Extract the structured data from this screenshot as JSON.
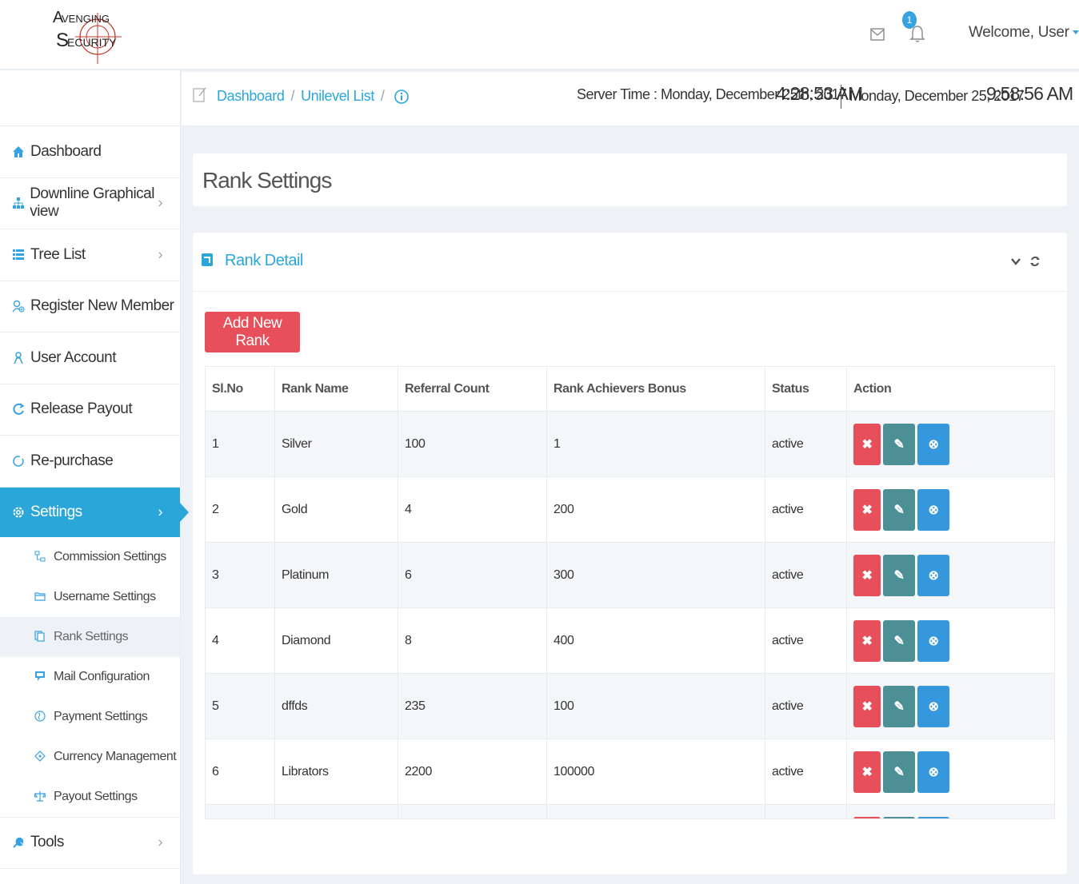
{
  "brand": {
    "logo_lines": [
      "VENGING",
      "ECURITY"
    ],
    "logo_initials": [
      "A",
      "S"
    ]
  },
  "header": {
    "notification_count": "1",
    "welcome": "Welcome, User",
    "accent": "#2ba6d9"
  },
  "sidebar": {
    "items": [
      {
        "label": "Dashboard",
        "icon": "home-icon"
      },
      {
        "label": "Downline Graphical view",
        "icon": "sitemap-icon"
      },
      {
        "label": "Tree List",
        "icon": "list-icon"
      },
      {
        "label": "Register New Member",
        "icon": "user-add-icon"
      },
      {
        "label": "User Account",
        "icon": "user-icon"
      },
      {
        "label": "Release Payout",
        "icon": "refresh-icon"
      },
      {
        "label": "Re-purchase",
        "icon": "circle-icon"
      },
      {
        "label": "Settings",
        "icon": "gear-icon"
      }
    ],
    "sub_items": [
      {
        "label": "Commission Settings",
        "icon": "network-icon"
      },
      {
        "label": "Username Settings",
        "icon": "folder-icon"
      },
      {
        "label": "Rank Settings",
        "icon": "copy-icon"
      },
      {
        "label": "Mail Configuration",
        "icon": "comment-icon"
      },
      {
        "label": "Payment Settings",
        "icon": "globe-icon"
      },
      {
        "label": "Currency Management",
        "icon": "diamond-icon"
      },
      {
        "label": "Payout Settings",
        "icon": "balance-icon"
      }
    ],
    "tools": {
      "label": "Tools",
      "icon": "wrench-icon"
    }
  },
  "breadcrumb": {
    "items": [
      "Dashboard",
      "Unilevel List"
    ],
    "separator": "/"
  },
  "clock": {
    "server_label": "Server Time : Monday, December 25th, 2017",
    "server_time": "4:28:53 AM",
    "local_date": "Monday, December 25, 2017",
    "local_time": "9:58:56 AM"
  },
  "page": {
    "title": "Rank Settings"
  },
  "portlet": {
    "title": "Rank Detail",
    "add_button": "Add New Rank"
  },
  "table": {
    "headers": [
      "Sl.No",
      "Rank Name",
      "Referral Count",
      "Rank Achievers Bonus",
      "Status",
      "Action"
    ],
    "rows": [
      [
        "1",
        "Silver",
        "100",
        "1",
        "active"
      ],
      [
        "2",
        "Gold",
        "4",
        "200",
        "active"
      ],
      [
        "3",
        "Platinum",
        "6",
        "300",
        "active"
      ],
      [
        "4",
        "Diamond",
        "8",
        "400",
        "active"
      ],
      [
        "5",
        "dffds",
        "235",
        "100",
        "active"
      ],
      [
        "6",
        "Librators",
        "2200",
        "100000",
        "active"
      ],
      [
        "",
        "",
        "",
        "",
        ""
      ]
    ],
    "action_glyphs": {
      "delete": "✖",
      "edit": "✎",
      "view": "⊗"
    }
  }
}
